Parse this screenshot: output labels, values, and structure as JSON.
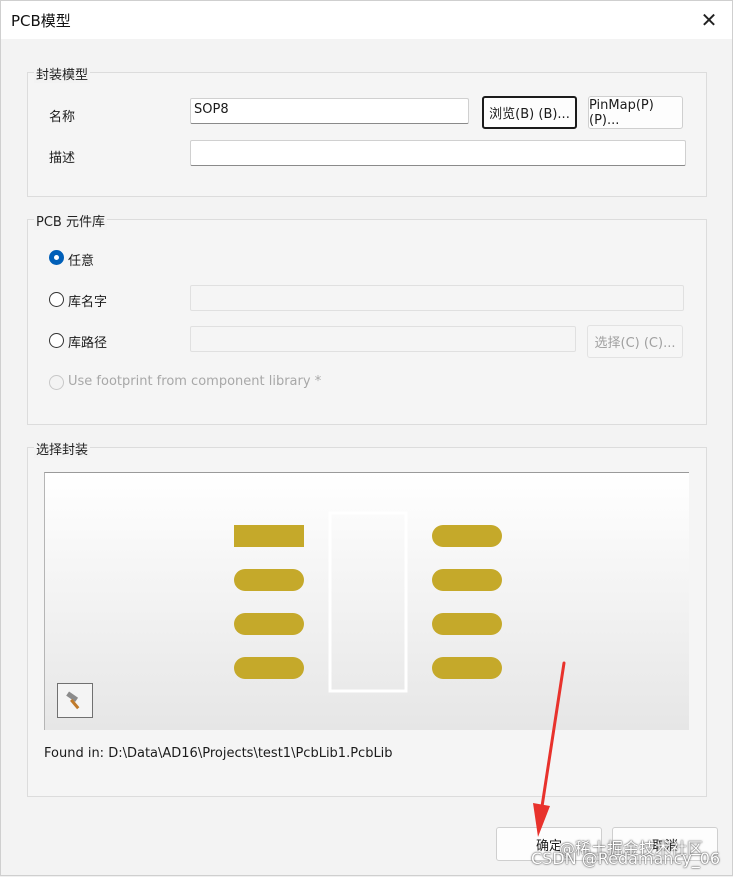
{
  "window": {
    "title": "PCB模型",
    "close_glyph": "✕"
  },
  "footprint_model": {
    "legend": "封装模型",
    "name_label": "名称",
    "name_value": "SOP8",
    "browse_button": "浏览(B) (B)...",
    "pinmap_button": "PinMap(P) (P)...",
    "desc_label": "描述",
    "desc_value": ""
  },
  "pcb_library": {
    "legend": "PCB 元件库",
    "options": [
      {
        "label": "任意",
        "checked": true,
        "disabled": false
      },
      {
        "label": "库名字",
        "checked": false,
        "disabled": false
      },
      {
        "label": "库路径",
        "checked": false,
        "disabled": false
      },
      {
        "label": "Use footprint from component library *",
        "checked": false,
        "disabled": true
      }
    ],
    "lib_name_value": "",
    "lib_path_value": "",
    "choose_button": "选择(C) (C)..."
  },
  "select_footprint": {
    "legend": "选择封装",
    "found_in": "Found in:  D:\\Data\\AD16\\Projects\\test1\\PcbLib1.PcbLib",
    "pad_color": "#c5a92a",
    "tool_icon": "hammer-icon"
  },
  "footer": {
    "ok_button": "确定",
    "cancel_button": "取消"
  },
  "watermarks": [
    "@稀土掘金技术社区",
    "CSDN @Redamancy_06"
  ]
}
